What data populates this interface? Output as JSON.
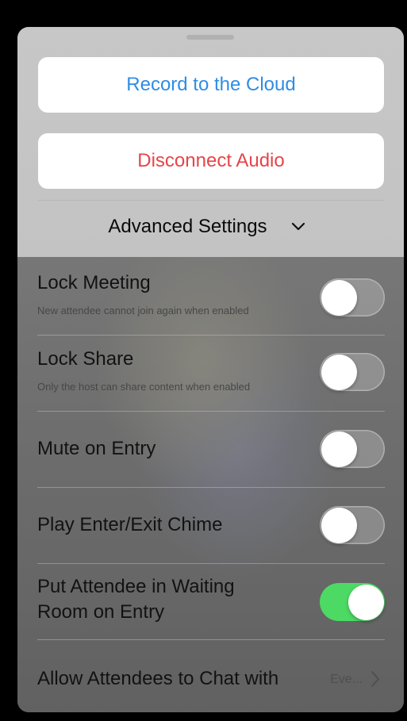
{
  "sheet": {
    "buttons": {
      "record": "Record to the Cloud",
      "disconnect": "Disconnect Audio"
    },
    "advanced_settings": {
      "label": "Advanced Settings",
      "icon": "chevron-down-icon"
    },
    "settings": [
      {
        "title": "Lock Meeting",
        "subtitle": "New attendee cannot join again when enabled",
        "enabled": false
      },
      {
        "title": "Lock Share",
        "subtitle": "Only the host can share content when enabled",
        "enabled": false
      },
      {
        "title": "Mute on Entry",
        "enabled": false
      },
      {
        "title": "Play Enter/Exit Chime",
        "enabled": false
      },
      {
        "title_line1": "Put Attendee in Waiting",
        "title_line2": "Room on Entry",
        "enabled": true
      }
    ],
    "chat": {
      "title": "Allow Attendees to Chat with",
      "value": "Eve...",
      "icon": "chevron-right-icon"
    }
  },
  "colors": {
    "record_text": "#2f8de4",
    "disconnect_text": "#e5454a",
    "toggle_on": "#4cd964"
  }
}
